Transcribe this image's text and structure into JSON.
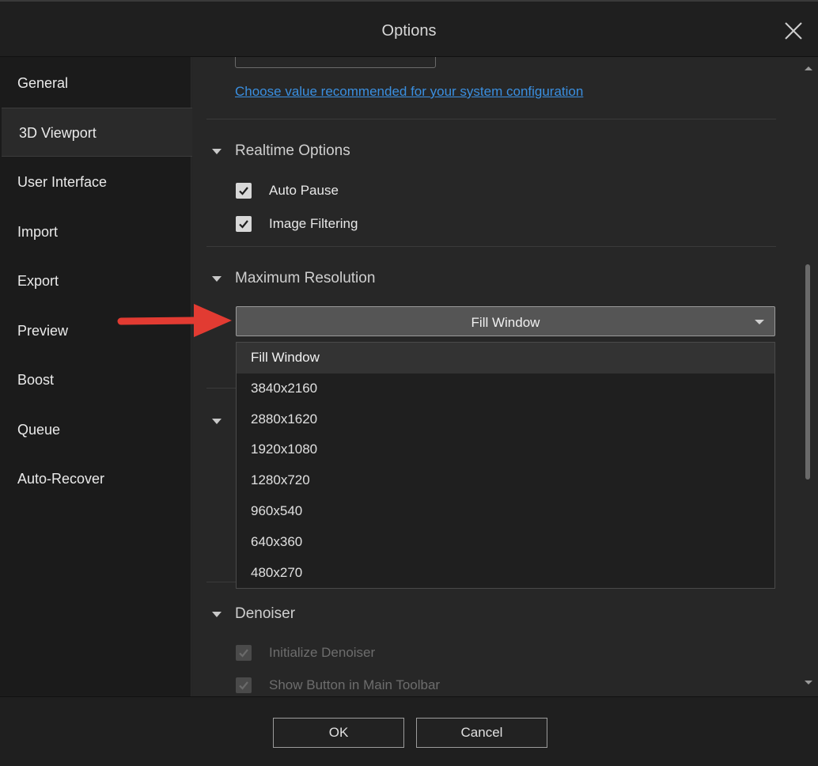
{
  "window": {
    "title": "Options"
  },
  "sidebar": {
    "items": [
      {
        "label": "General"
      },
      {
        "label": "3D Viewport",
        "active": true
      },
      {
        "label": "User Interface"
      },
      {
        "label": "Import"
      },
      {
        "label": "Export"
      },
      {
        "label": "Preview"
      },
      {
        "label": "Boost"
      },
      {
        "label": "Queue"
      },
      {
        "label": "Auto-Recover"
      }
    ]
  },
  "main": {
    "recommend_link": "Choose value recommended for your system configuration",
    "realtime": {
      "title": "Realtime Options",
      "auto_pause": {
        "label": "Auto Pause",
        "checked": true
      },
      "image_filtering": {
        "label": "Image Filtering",
        "checked": true
      }
    },
    "max_resolution": {
      "title": "Maximum Resolution",
      "selected": "Fill Window",
      "options": [
        "Fill Window",
        "3840x2160",
        "2880x1620",
        "1920x1080",
        "1280x720",
        "960x540",
        "640x360",
        "480x270"
      ]
    },
    "denoiser": {
      "title": "Denoiser",
      "initialize": {
        "label": "Initialize Denoiser",
        "checked": true,
        "disabled": true
      },
      "show_button": {
        "label": "Show Button in Main Toolbar",
        "checked": true,
        "disabled": true
      }
    }
  },
  "footer": {
    "ok_label": "OK",
    "cancel_label": "Cancel"
  },
  "colors": {
    "link": "#3a8fe0",
    "annotation_arrow": "#e23b32"
  }
}
